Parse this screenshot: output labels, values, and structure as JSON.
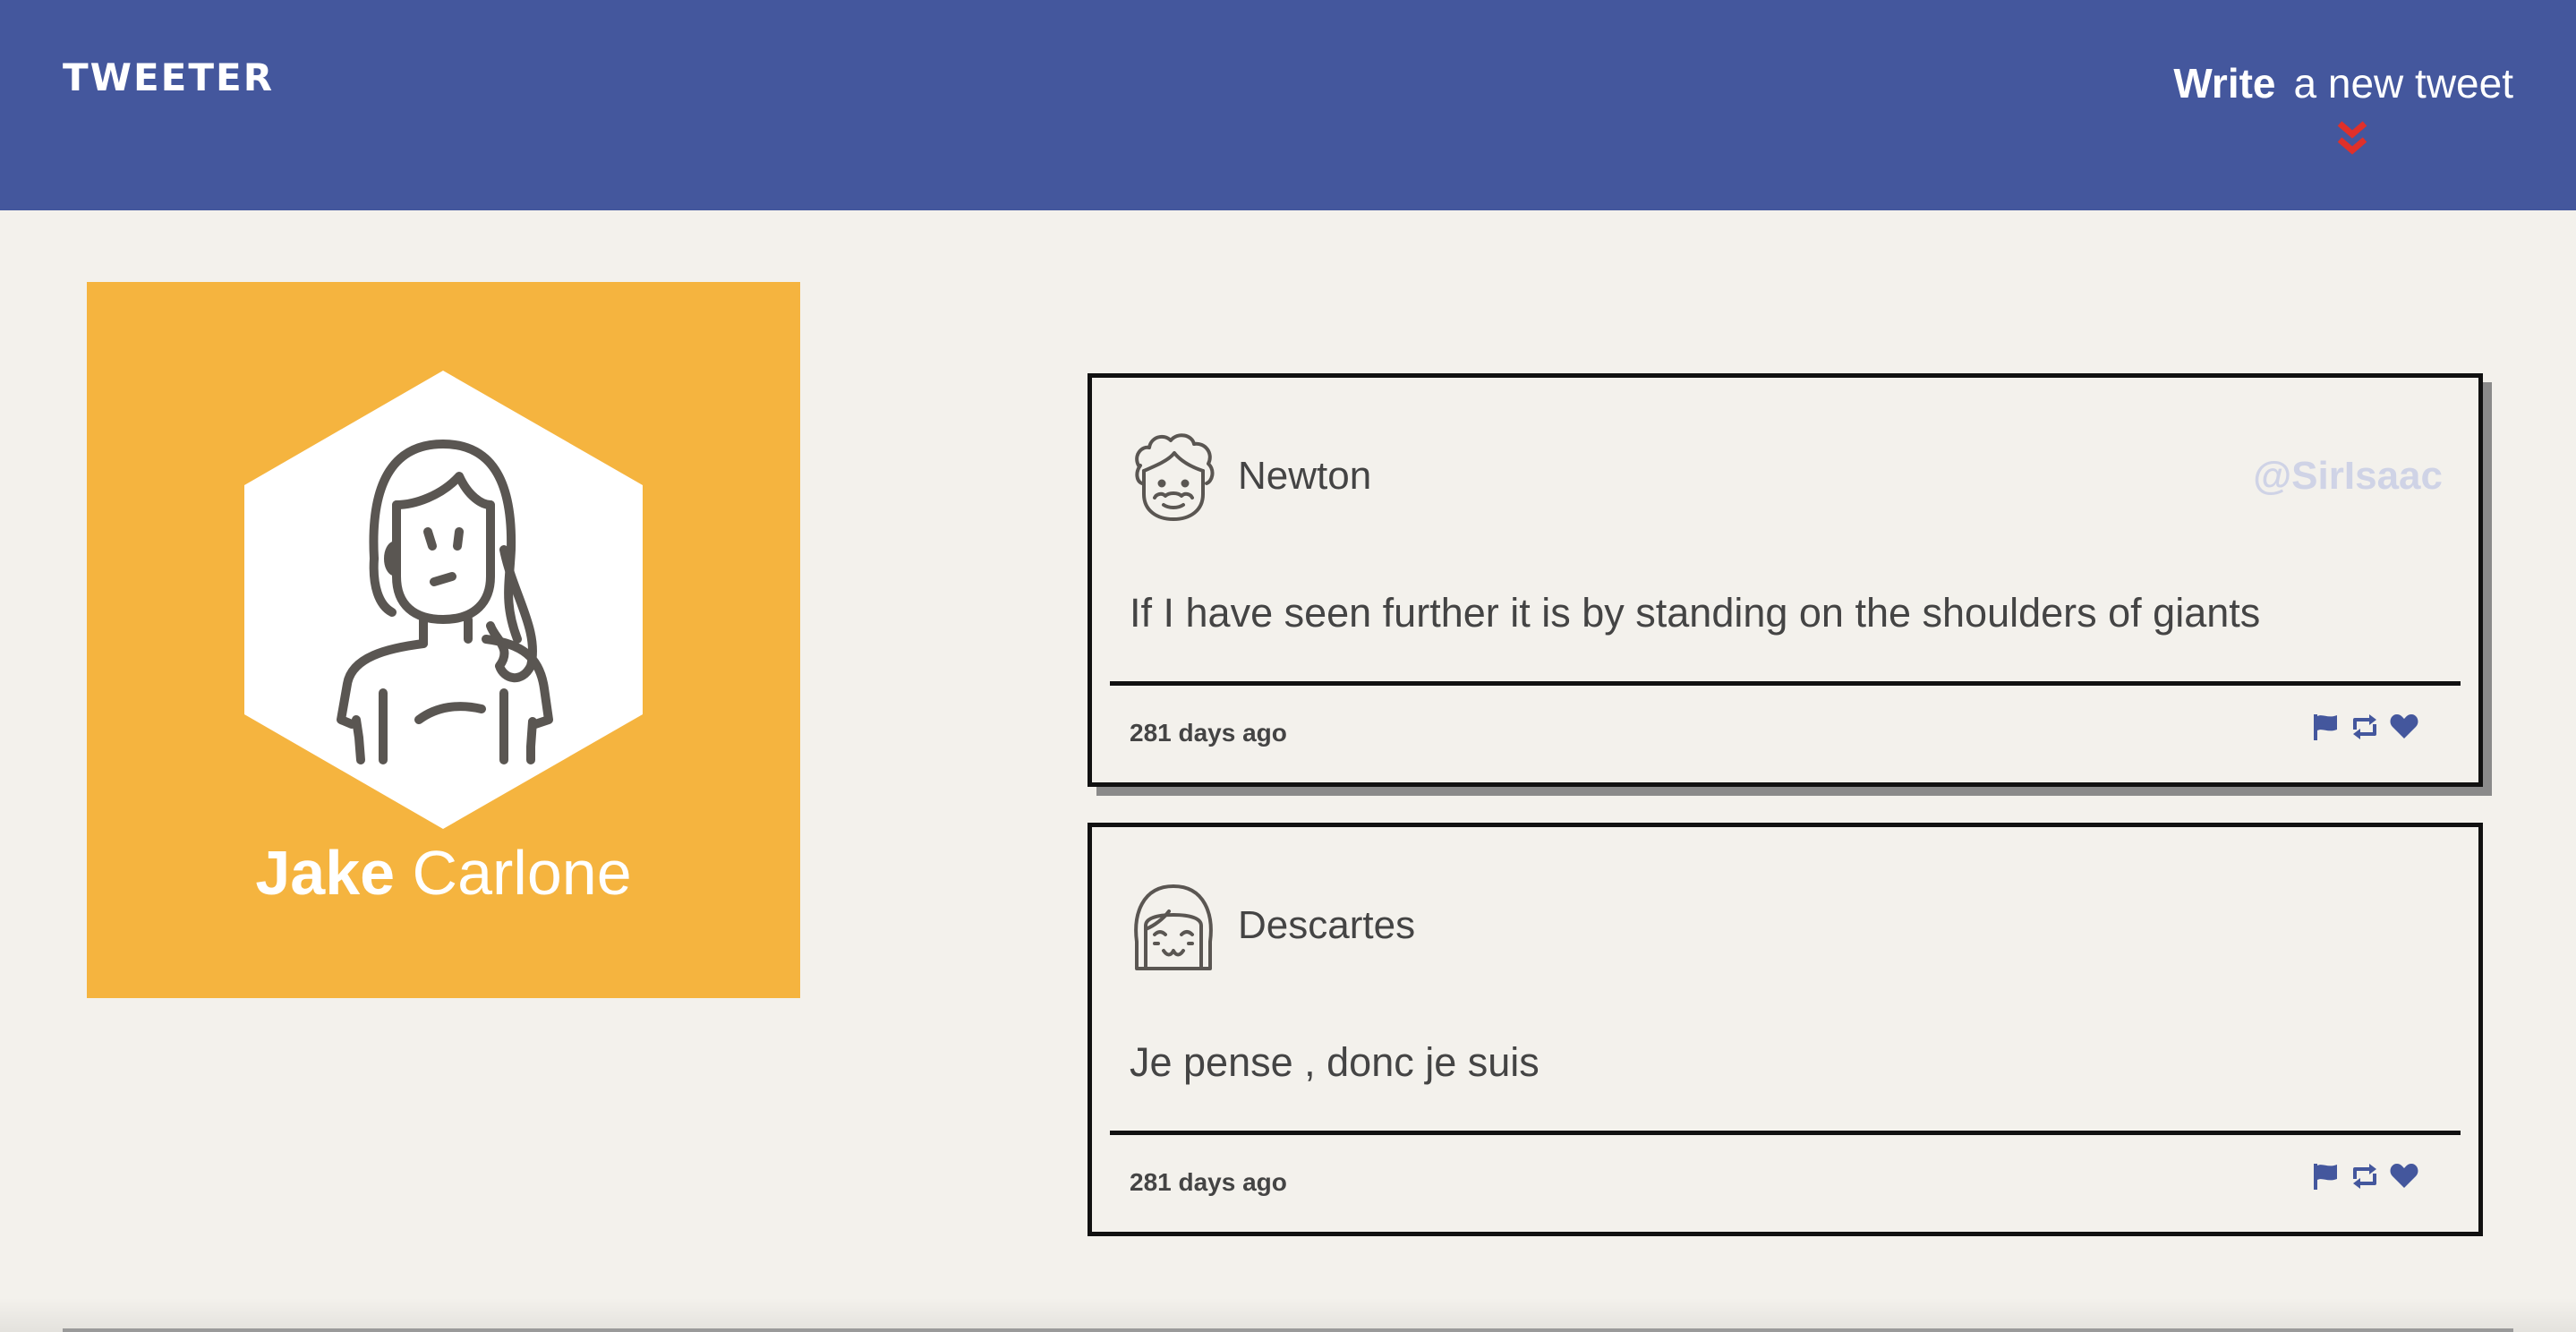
{
  "header": {
    "logo": "TWEETER",
    "compose": {
      "bold_label": "Write",
      "light_label": "a new tweet",
      "arrow_icon": "double-chevron-down-icon",
      "arrow_color": "#e0302a"
    },
    "background_color": "#44579d"
  },
  "profile": {
    "first_name": "Jake",
    "last_name": "Carlone",
    "avatar_icon": "user-avatar-icon",
    "background_color": "#f5b43f"
  },
  "tweets": [
    {
      "name": "Newton",
      "handle": "@SirIsaac",
      "text": "If I have seen further it is by standing on the shoulders of giants",
      "time": "281 days ago",
      "avatar_icon": "curly-hair-avatar-icon",
      "actions": [
        "flag-icon",
        "retweet-icon",
        "heart-icon"
      ]
    },
    {
      "name": "Descartes",
      "handle": "",
      "text": "Je pense , donc je suis",
      "time": "281 days ago",
      "avatar_icon": "bob-hair-avatar-icon",
      "actions": [
        "flag-icon",
        "retweet-icon",
        "heart-icon"
      ]
    }
  ],
  "colors": {
    "page_background": "#f3f1ec",
    "action_icon": "#44579d",
    "text": "#444444"
  }
}
